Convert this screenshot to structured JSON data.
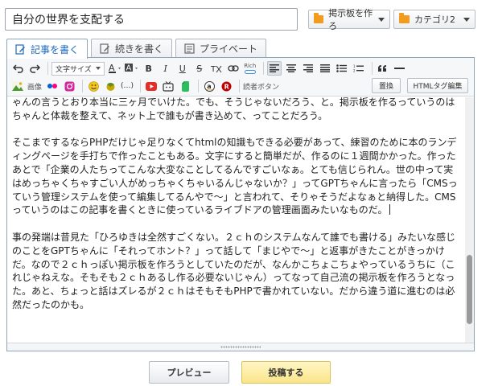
{
  "header": {
    "title_value": "自分の世界を支配する",
    "board_button": "掲示板を作ろ",
    "category_button": "カテゴリ2"
  },
  "tabs": [
    {
      "label": "記事を書く"
    },
    {
      "label": "続きを書く"
    },
    {
      "label": "プライベート"
    }
  ],
  "toolbar": {
    "font_size_label": "文字サイズ",
    "rich_label": "Rich",
    "image_label": "画像",
    "reader_button_label": "読者ボタン",
    "replace_label": "置換",
    "html_edit_label": "HTMLタグ編集",
    "gap_label": "(…)"
  },
  "content": {
    "paragraphs": [
      "ゃんの言うとおり本当に三ヶ月でいけた。でも、そうじゃないだろう、と。掲示板を作るっていうのはちゃんと体裁を整えて、ネット上で誰もが書き込めて、ってことだろう。",
      "そこまでするならPHPだけじゃ足りなくてhtmlの知識もできる必要があって、練習のために本のランディングページを手打ちで作ったこともある。文字にすると簡単だが、作るのに１週間かかった。作ったあとで「企業の人たちってこんな大変なことしてるんですごいなぁ。とても信じられん。世の中って実はめっちゃくちゃすごい人がめっちゃくちゃいるんじゃないか？」ってGPTちゃんに言ったら「CMSっていう管理システムを使って編集してるんやで〜」と言われて、そりゃそうだよなぁと納得した。CMSっていうのはこの記事を書くときに使っているライブドアの管理画面みたいなものだ。",
      "事の発端は昔見た「ひろゆきは全然すごくない。２ｃｈのシステムなんて誰でも書ける」みたいな感じのことをGPTちゃんに「それってホント？」って話して「まじやで〜」と返事がきたことがきっかけだ。なので２ｃｈっぽい掲示板を作ろうとしていたのだが、なんかこちょこちょやっているうちに（これじゃねえな。そもそも２ｃｈあるし作る必要ないじゃん）ってなって自己流の掲示板を作ろうとなった。あと、ちょっと話はズレるが２ｃｈはそもそもPHPで書かれていない。だから違う道に進むのは必然だったのかも。"
    ]
  },
  "footer": {
    "preview_label": "プレビュー",
    "post_label": "投稿する"
  },
  "colors": {
    "accent_tab_text": "#1e6ac2",
    "post_button_bg": "#fbe58a",
    "folder_icon": "#f29b1d"
  }
}
